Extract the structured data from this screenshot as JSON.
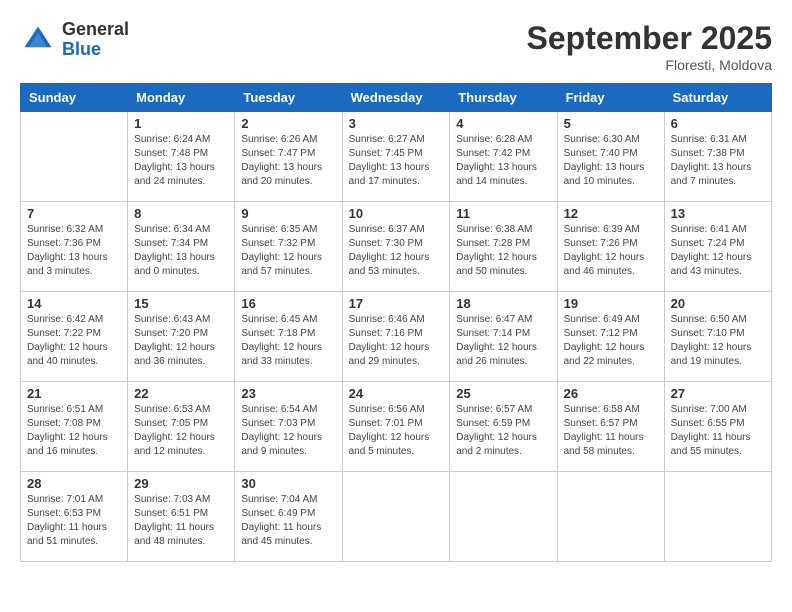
{
  "header": {
    "logo": {
      "general": "General",
      "blue": "Blue"
    },
    "title": "September 2025",
    "location": "Floresti, Moldova"
  },
  "days_of_week": [
    "Sunday",
    "Monday",
    "Tuesday",
    "Wednesday",
    "Thursday",
    "Friday",
    "Saturday"
  ],
  "weeks": [
    [
      {
        "day": "",
        "info": ""
      },
      {
        "day": "1",
        "info": "Sunrise: 6:24 AM\nSunset: 7:48 PM\nDaylight: 13 hours\nand 24 minutes."
      },
      {
        "day": "2",
        "info": "Sunrise: 6:26 AM\nSunset: 7:47 PM\nDaylight: 13 hours\nand 20 minutes."
      },
      {
        "day": "3",
        "info": "Sunrise: 6:27 AM\nSunset: 7:45 PM\nDaylight: 13 hours\nand 17 minutes."
      },
      {
        "day": "4",
        "info": "Sunrise: 6:28 AM\nSunset: 7:42 PM\nDaylight: 13 hours\nand 14 minutes."
      },
      {
        "day": "5",
        "info": "Sunrise: 6:30 AM\nSunset: 7:40 PM\nDaylight: 13 hours\nand 10 minutes."
      },
      {
        "day": "6",
        "info": "Sunrise: 6:31 AM\nSunset: 7:38 PM\nDaylight: 13 hours\nand 7 minutes."
      }
    ],
    [
      {
        "day": "7",
        "info": "Sunrise: 6:32 AM\nSunset: 7:36 PM\nDaylight: 13 hours\nand 3 minutes."
      },
      {
        "day": "8",
        "info": "Sunrise: 6:34 AM\nSunset: 7:34 PM\nDaylight: 13 hours\nand 0 minutes."
      },
      {
        "day": "9",
        "info": "Sunrise: 6:35 AM\nSunset: 7:32 PM\nDaylight: 12 hours\nand 57 minutes."
      },
      {
        "day": "10",
        "info": "Sunrise: 6:37 AM\nSunset: 7:30 PM\nDaylight: 12 hours\nand 53 minutes."
      },
      {
        "day": "11",
        "info": "Sunrise: 6:38 AM\nSunset: 7:28 PM\nDaylight: 12 hours\nand 50 minutes."
      },
      {
        "day": "12",
        "info": "Sunrise: 6:39 AM\nSunset: 7:26 PM\nDaylight: 12 hours\nand 46 minutes."
      },
      {
        "day": "13",
        "info": "Sunrise: 6:41 AM\nSunset: 7:24 PM\nDaylight: 12 hours\nand 43 minutes."
      }
    ],
    [
      {
        "day": "14",
        "info": "Sunrise: 6:42 AM\nSunset: 7:22 PM\nDaylight: 12 hours\nand 40 minutes."
      },
      {
        "day": "15",
        "info": "Sunrise: 6:43 AM\nSunset: 7:20 PM\nDaylight: 12 hours\nand 36 minutes."
      },
      {
        "day": "16",
        "info": "Sunrise: 6:45 AM\nSunset: 7:18 PM\nDaylight: 12 hours\nand 33 minutes."
      },
      {
        "day": "17",
        "info": "Sunrise: 6:46 AM\nSunset: 7:16 PM\nDaylight: 12 hours\nand 29 minutes."
      },
      {
        "day": "18",
        "info": "Sunrise: 6:47 AM\nSunset: 7:14 PM\nDaylight: 12 hours\nand 26 minutes."
      },
      {
        "day": "19",
        "info": "Sunrise: 6:49 AM\nSunset: 7:12 PM\nDaylight: 12 hours\nand 22 minutes."
      },
      {
        "day": "20",
        "info": "Sunrise: 6:50 AM\nSunset: 7:10 PM\nDaylight: 12 hours\nand 19 minutes."
      }
    ],
    [
      {
        "day": "21",
        "info": "Sunrise: 6:51 AM\nSunset: 7:08 PM\nDaylight: 12 hours\nand 16 minutes."
      },
      {
        "day": "22",
        "info": "Sunrise: 6:53 AM\nSunset: 7:05 PM\nDaylight: 12 hours\nand 12 minutes."
      },
      {
        "day": "23",
        "info": "Sunrise: 6:54 AM\nSunset: 7:03 PM\nDaylight: 12 hours\nand 9 minutes."
      },
      {
        "day": "24",
        "info": "Sunrise: 6:56 AM\nSunset: 7:01 PM\nDaylight: 12 hours\nand 5 minutes."
      },
      {
        "day": "25",
        "info": "Sunrise: 6:57 AM\nSunset: 6:59 PM\nDaylight: 12 hours\nand 2 minutes."
      },
      {
        "day": "26",
        "info": "Sunrise: 6:58 AM\nSunset: 6:57 PM\nDaylight: 11 hours\nand 58 minutes."
      },
      {
        "day": "27",
        "info": "Sunrise: 7:00 AM\nSunset: 6:55 PM\nDaylight: 11 hours\nand 55 minutes."
      }
    ],
    [
      {
        "day": "28",
        "info": "Sunrise: 7:01 AM\nSunset: 6:53 PM\nDaylight: 11 hours\nand 51 minutes."
      },
      {
        "day": "29",
        "info": "Sunrise: 7:03 AM\nSunset: 6:51 PM\nDaylight: 11 hours\nand 48 minutes."
      },
      {
        "day": "30",
        "info": "Sunrise: 7:04 AM\nSunset: 6:49 PM\nDaylight: 11 hours\nand 45 minutes."
      },
      {
        "day": "",
        "info": ""
      },
      {
        "day": "",
        "info": ""
      },
      {
        "day": "",
        "info": ""
      },
      {
        "day": "",
        "info": ""
      }
    ]
  ]
}
